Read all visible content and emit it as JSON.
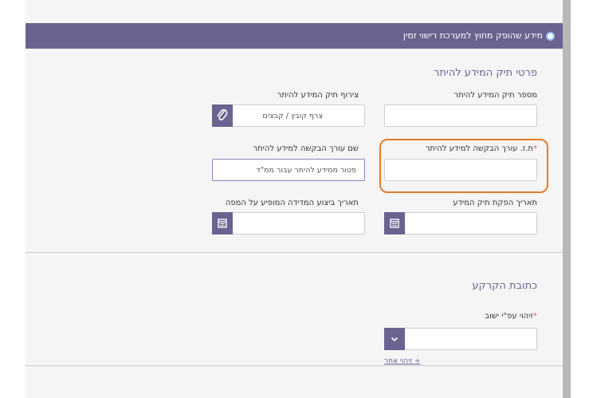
{
  "header": {
    "title": "מידע שהופק מחוץ למערכת רישוי זמין"
  },
  "section1": {
    "title": "פרטי תיק המידע להיתר",
    "fields": {
      "file_number": {
        "label": "מספר תיק המידע להיתר",
        "value": ""
      },
      "attach": {
        "label": "צירוף תיק המידע להיתר",
        "placeholder": "צרף קובץ / קבצים"
      },
      "requester_id": {
        "label": "ת.ז. עורך הבקשה למידע להיתר",
        "required_mark": "*",
        "value": ""
      },
      "requester_name": {
        "label": "שם עורך הבקשה למידע להיתר",
        "placeholder": "פטור ממידע להיתר עבור ממ\"ד"
      },
      "issue_date": {
        "label": "תאריך הפקת תיק המידע",
        "value": ""
      },
      "measure_date": {
        "label": "תאריך ביצוע המדידה המופיע על המפה",
        "value": ""
      }
    }
  },
  "section2": {
    "title": "כתובת הקרקע",
    "fields": {
      "settlement": {
        "label": "זיהוי עפ\"י ישוב",
        "required_mark": "*",
        "value": ""
      }
    },
    "other_id_link": "+ זיהוי אחר"
  },
  "colors": {
    "accent": "#6b6290",
    "highlight": "#e87c2a",
    "background": "#f5f5f5"
  },
  "icons": [
    "radio-icon",
    "paperclip-icon",
    "calendar-icon",
    "chevron-down-icon"
  ]
}
